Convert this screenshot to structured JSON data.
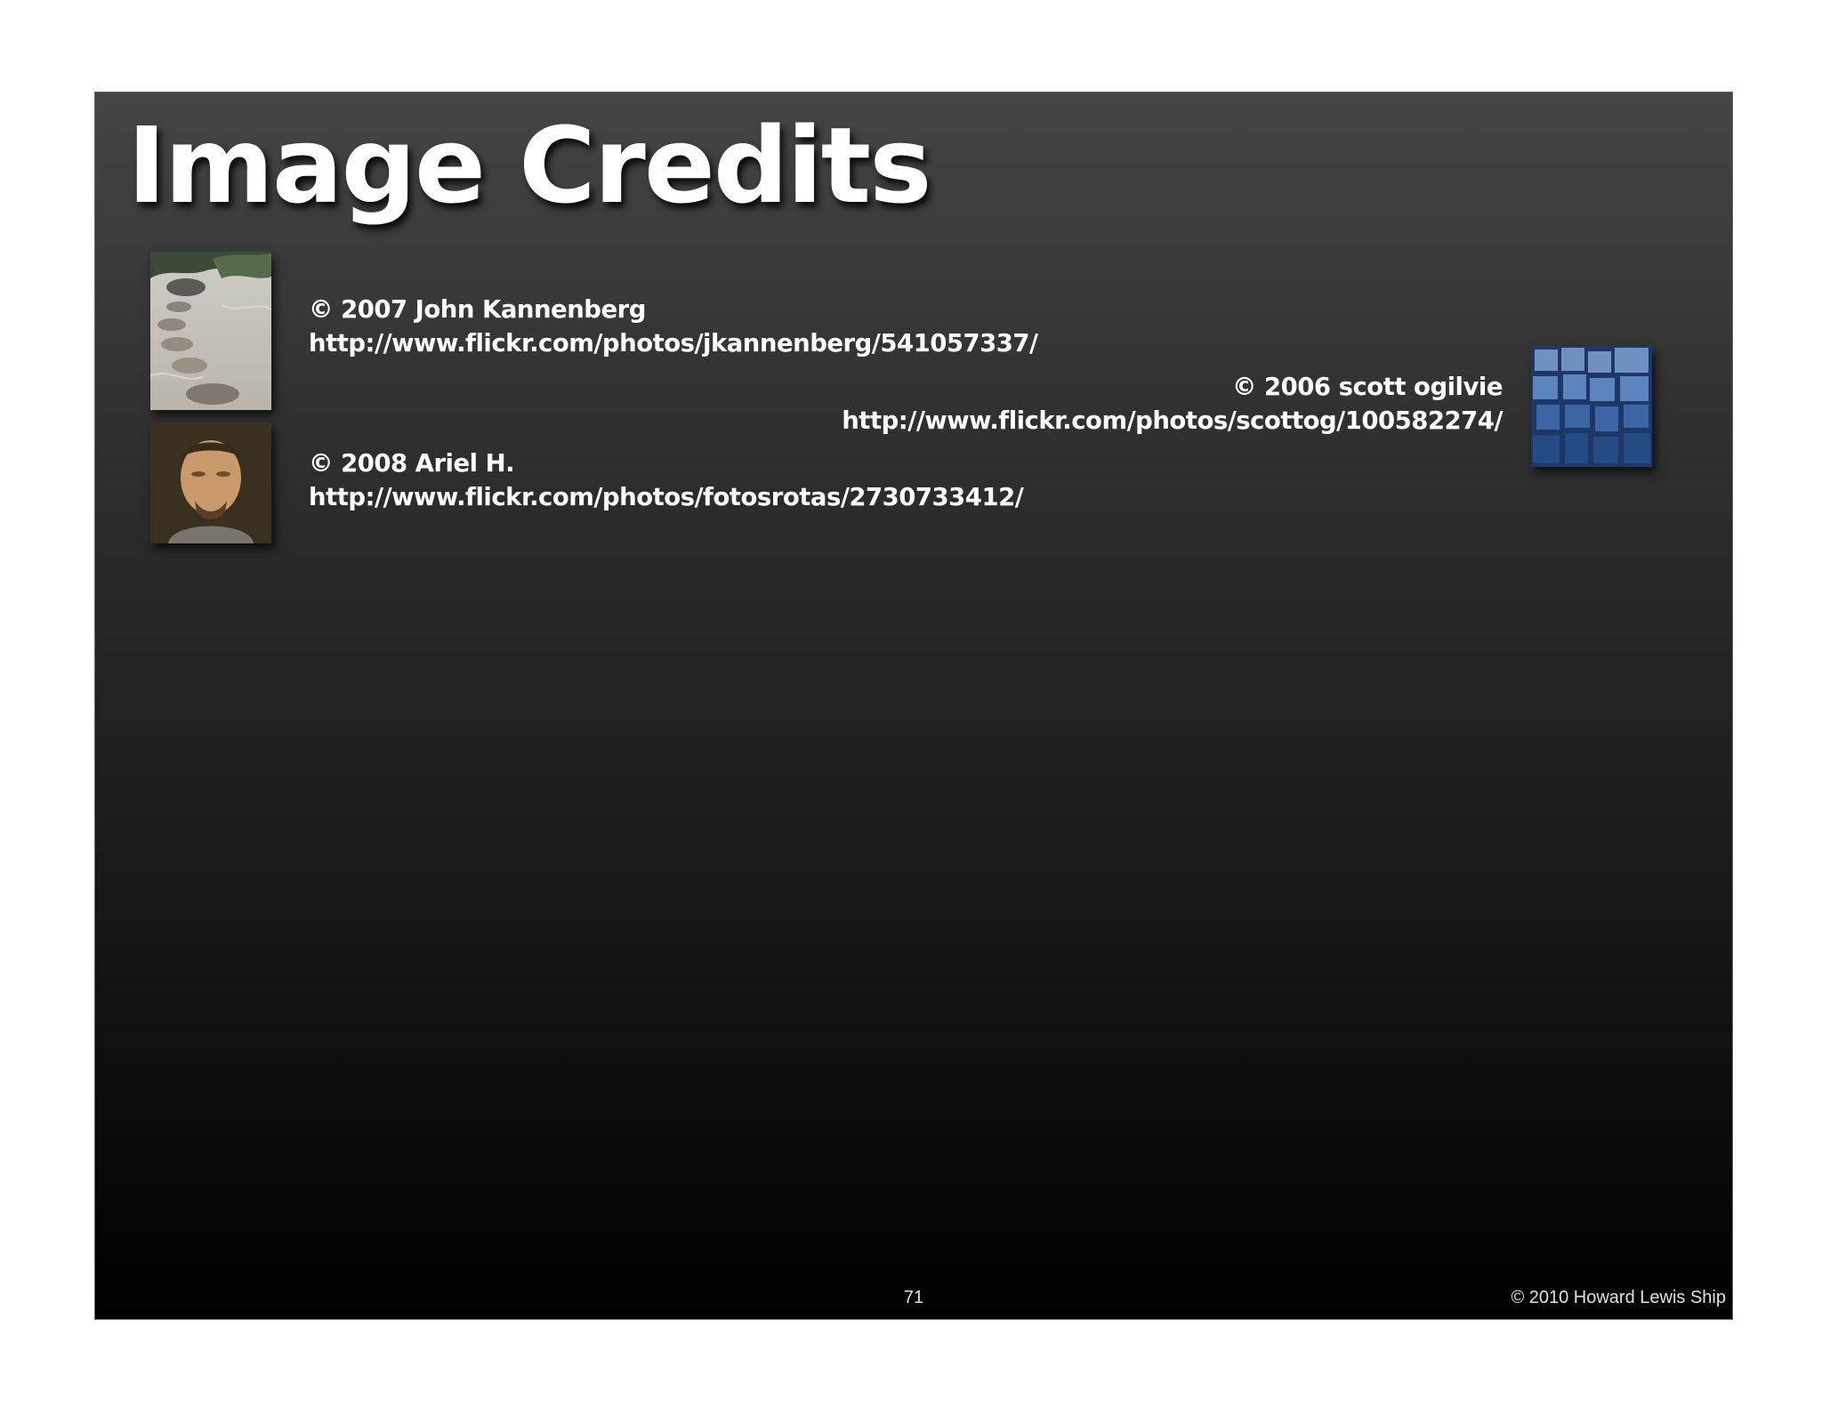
{
  "slide": {
    "title": "Image Credits",
    "credits": [
      {
        "copyright": "© 2007 John Kannenberg",
        "url": "http://www.flickr.com/photos/jkannenberg/541057337/",
        "thumbnail": "zen-garden-stepping-stones-photo"
      },
      {
        "copyright": "© 2006 scott ogilvie",
        "url": "http://www.flickr.com/photos/scottog/100582274/",
        "thumbnail": "blue-cubes-photo"
      },
      {
        "copyright": "© 2008 Ariel H.",
        "url": "http://www.flickr.com/photos/fotosrotas/2730733412/",
        "thumbnail": "man-portrait-photo"
      }
    ],
    "page_number": "71",
    "footer": "© 2010 Howard Lewis Ship"
  }
}
